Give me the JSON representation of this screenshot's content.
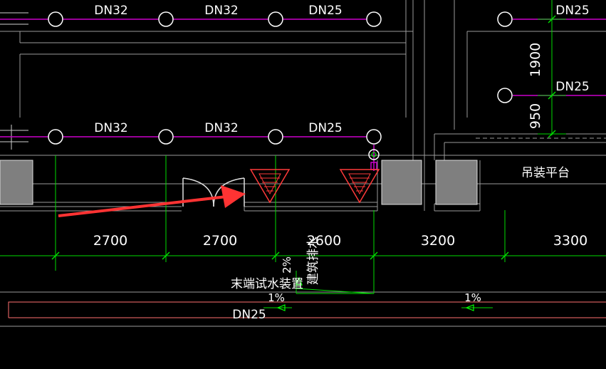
{
  "pipe_labels": {
    "top_row": [
      "DN32",
      "DN32",
      "DN25"
    ],
    "mid_row": [
      "DN32",
      "DN32",
      "DN25"
    ],
    "right_top": "DN25",
    "right_mid": "DN25",
    "bottom_pipe": "DN25"
  },
  "vertical_dims": {
    "upper": "1900",
    "lower": "950"
  },
  "horizontal_dims": [
    "2700",
    "2700",
    "2600",
    "3200",
    "3300"
  ],
  "labels": {
    "lifting_platform": "吊装平台",
    "end_test_device": "末端试水装置",
    "building_drain": "建筑排水",
    "slope_vertical": "2%",
    "slope_left": "1%",
    "slope_right": "1%"
  },
  "colors": {
    "background": "#000000",
    "pipe": "#cc00cc",
    "dimension": "#00ff00",
    "wall": "#c0c0c0",
    "column": "#808080",
    "arrow": "#ff3333",
    "valve": "#ff4444",
    "drain_line": "#ff6666"
  }
}
